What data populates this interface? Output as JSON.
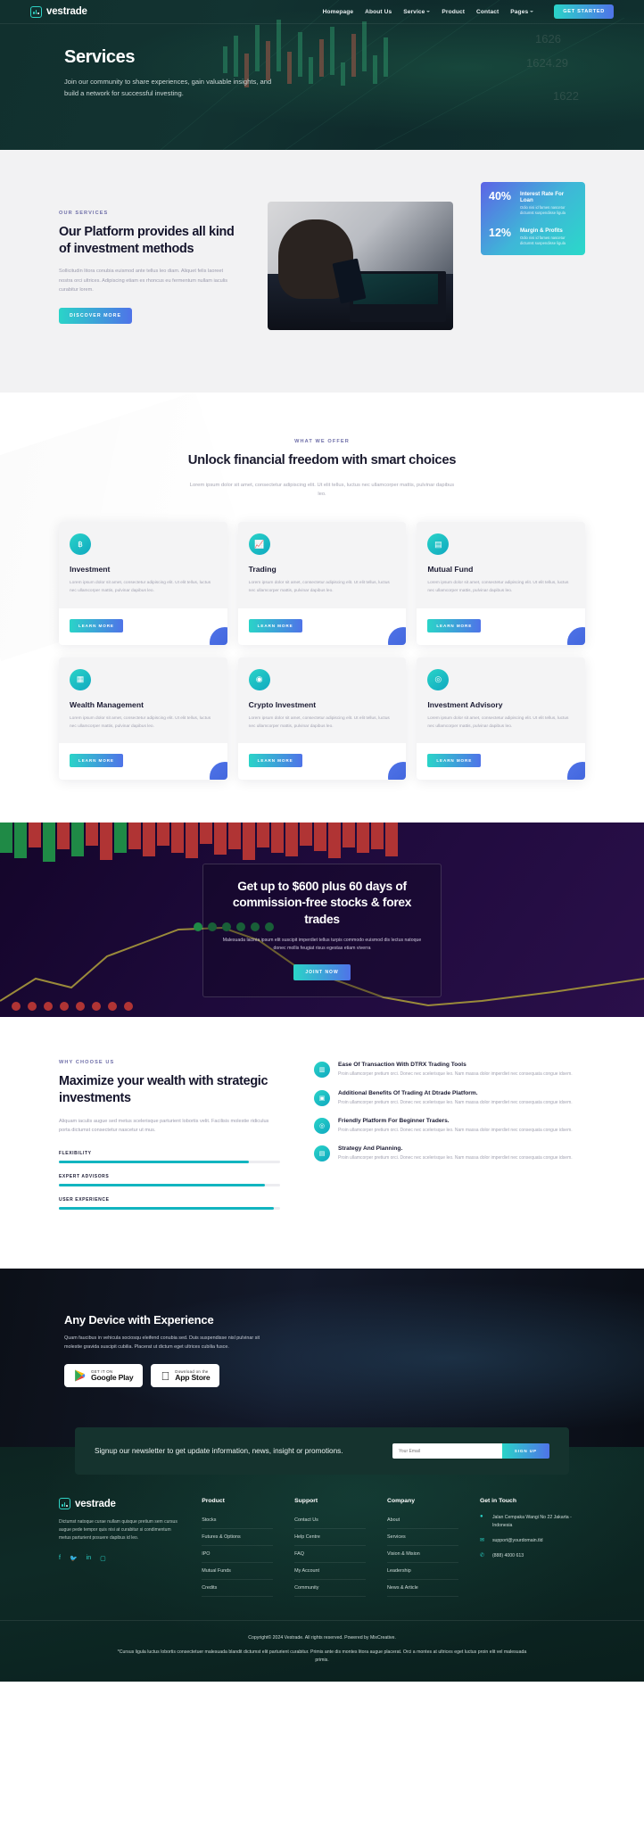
{
  "brand": {
    "name": "vestrade",
    "mark": "bar-chart-logo"
  },
  "nav": {
    "links": [
      {
        "label": "Homepage",
        "caret": false
      },
      {
        "label": "About Us",
        "caret": false
      },
      {
        "label": "Service",
        "caret": true
      },
      {
        "label": "Product",
        "caret": false
      },
      {
        "label": "Contact",
        "caret": false
      },
      {
        "label": "Pages",
        "caret": true
      }
    ],
    "cta": "GET STARTED"
  },
  "hero": {
    "title": "Services",
    "subtitle": "Join our community to share experiences, gain valuable insights, and build a network for successful investing."
  },
  "platform": {
    "eyebrow": "OUR SERVICES",
    "title": "Our Platform provides all kind of investment methods",
    "body": "Sollicitudin litora conubia euismod ante tellus leo diam. Aliquet felis laoreet nostra orci ultrices. Adipiscing etiam ex rhoncus eu fermentum nullam iaculis curabitur lorem.",
    "button": "DISCOVER MORE",
    "stats": [
      {
        "value": "40%",
        "title": "Interest Rate For Loan",
        "desc": "Odio nisi id fames nascetur dictumst suspendisse ligula"
      },
      {
        "value": "12%",
        "title": "Margin & Profits",
        "desc": "Odio nisi id fames nascetur dictumst suspendisse ligula"
      }
    ]
  },
  "offer": {
    "eyebrow": "WHAT WE OFFER",
    "title": "Unlock financial freedom with smart choices",
    "subtitle": "Lorem ipsum dolor sit amet, consectetur adipiscing elit. Ut elit tellus, luctus nec ullamcorper mattis, pulvinar dapibus leo.",
    "card_body": "Lorem ipsum dolor sit amet, consectetur adipiscing elit. Ut elit tellus, luctus nec ullamcorper mattis, pulvinar dapibus leo.",
    "card_button": "LEARN MORE",
    "cards": [
      {
        "title": "Investment",
        "icon": "bitcoin-icon"
      },
      {
        "title": "Trading",
        "icon": "line-chart-icon"
      },
      {
        "title": "Mutual Fund",
        "icon": "document-chart-icon"
      },
      {
        "title": "Wealth Management",
        "icon": "briefcase-icon"
      },
      {
        "title": "Crypto Investment",
        "icon": "coin-icon"
      },
      {
        "title": "Investment Advisory",
        "icon": "advisory-icon"
      }
    ]
  },
  "promo": {
    "title": "Get up to $600 plus 60 days of commission-free stocks & forex trades",
    "body": "Malesuada lacinia ipsum elit suscipit imperdiet tellus turpis commodo euismod dis lectus natoque donec mollis feugiat risus egestas etiam viverra",
    "button": "JOINT NOW"
  },
  "why": {
    "eyebrow": "WHY CHOOSE US",
    "title": "Maximize your wealth with strategic investments",
    "body": "Aliquam iaculis augue sed metus scelerisque parturient lobortis velit. Facilisis molestie ridiculus porta dictumst consectetur nascetur ut mus.",
    "bars": [
      {
        "label": "FLEXIBILITY",
        "percent": 86
      },
      {
        "label": "EXPERT ADVISORS",
        "percent": 93
      },
      {
        "label": "USER EXPERIENCE",
        "percent": 97
      }
    ],
    "feature_body": "Proin ullamcorper pretium orci. Donec nec scelerisque leo. Nam massa dolor imperdiet nec consequata congue idsem.",
    "features": [
      {
        "title": "Ease Of Transaction With DTRX Trading Tools",
        "icon": "bar-chart-icon"
      },
      {
        "title": "Additional Benefits Of Trading At Dtrade Platform.",
        "icon": "monitor-icon"
      },
      {
        "title": "Friendly Platform For Beginner Traders.",
        "icon": "target-icon"
      },
      {
        "title": "Strategy And Planning.",
        "icon": "clipboard-icon"
      }
    ]
  },
  "device": {
    "title": "Any Device with Experience",
    "body": "Quam faucibus in vehicula sociosqu eleifend conubia sed. Duis suspendisse nisl pulvinar sit molestie gravida suscipit cubilia. Placerat ut dictum eget ultrices cubilia fusce.",
    "stores": [
      {
        "small": "GET IT ON",
        "large": "Google Play",
        "icon": "google-play-icon"
      },
      {
        "small": "Download on the",
        "large": "App Store",
        "icon": "apple-icon"
      }
    ]
  },
  "newsletter": {
    "text": "Signup our newsletter to get update information, news, insight or promotions.",
    "placeholder": "Your Email",
    "button": "SIGN UP"
  },
  "footer": {
    "about": "Dictumst natoque curae nullam quisque pretium sem cursus augue pede tempor quis nisi at curabitur si condimentum metus parturient posuere dapibus id leo.",
    "socials": [
      "facebook-icon",
      "twitter-icon",
      "linkedin-icon",
      "instagram-icon"
    ],
    "columns": [
      {
        "heading": "Product",
        "links": [
          "Stocks",
          "Futures & Options",
          "IPO",
          "Mutual Funds",
          "Credits"
        ]
      },
      {
        "heading": "Support",
        "links": [
          "Contact Us",
          "Help Centre",
          "FAQ",
          "My Account",
          "Community"
        ]
      },
      {
        "heading": "Company",
        "links": [
          "About",
          "Services",
          "Vision & Mision",
          "Leadership",
          "News & Article"
        ]
      }
    ],
    "touch": {
      "heading": "Get in Touch",
      "items": [
        {
          "icon": "location-pin-icon",
          "text": "Jalan Cempaka Wangi No 22 Jakarta - Indonesia"
        },
        {
          "icon": "mail-icon",
          "text": "support@yourdomain.tld"
        },
        {
          "icon": "phone-icon",
          "text": "(888) 4000 613"
        }
      ]
    },
    "copyright": "Copyright© 2024 Vestrade. All rights reserved. Powered by MixCreative.",
    "disclaimer": "*Cursus ligula luctus lobortis consectetuer malesuada blandit dictumst elit parturient curabitur. Primis ante dis montes litora augue placerat. Orci a montes at ultrices eget luctus proin elit vel malesuada primis."
  },
  "colors": {
    "accent_teal": "#2ad4c8",
    "accent_blue": "#4f73e8",
    "dark_green": "#11302e",
    "footer_green": "#0d2421"
  }
}
